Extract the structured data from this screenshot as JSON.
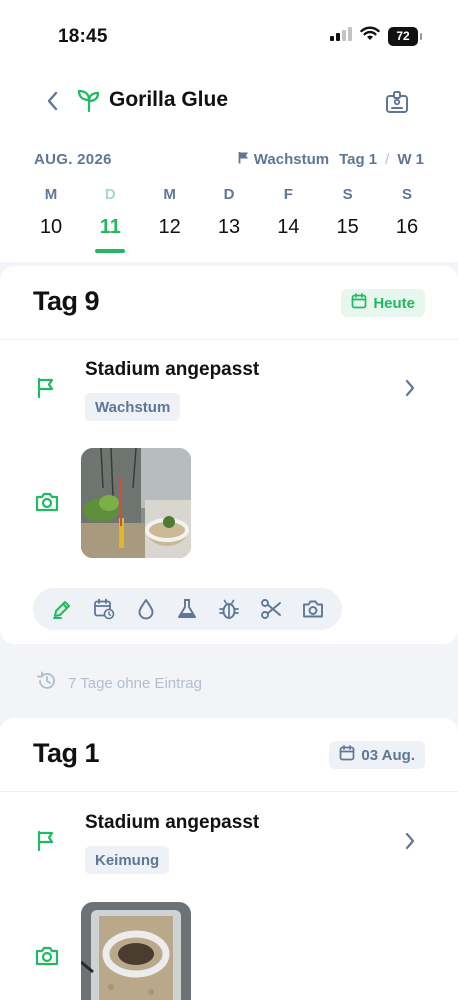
{
  "status_bar": {
    "time": "18:45",
    "battery": "72"
  },
  "header": {
    "title": "Gorilla Glue"
  },
  "calendar": {
    "month": "AUG. 2026",
    "phase": "Wachstum",
    "day_label": "Tag 1",
    "week_label": "W 1",
    "days": [
      {
        "weekday": "M",
        "num": "10"
      },
      {
        "weekday": "D",
        "num": "11"
      },
      {
        "weekday": "M",
        "num": "12"
      },
      {
        "weekday": "D",
        "num": "13"
      },
      {
        "weekday": "F",
        "num": "14"
      },
      {
        "weekday": "S",
        "num": "15"
      },
      {
        "weekday": "S",
        "num": "16"
      }
    ],
    "selected_index": 1
  },
  "cards": [
    {
      "title": "Tag 9",
      "badge": "Heute",
      "entry_title": "Stadium angepasst",
      "stage": "Wachstum",
      "actions": [
        "edit-icon",
        "calendar-repeat-icon",
        "water-drop-icon",
        "flask-icon",
        "bug-icon",
        "scissors-icon",
        "camera-icon"
      ]
    },
    {
      "title": "Tag 1",
      "badge": "03 Aug.",
      "entry_title": "Stadium angepasst",
      "stage": "Keimung"
    }
  ],
  "gap_notice": "7 Tage ohne Eintrag",
  "colors": {
    "accent": "#22b864",
    "muted": "#5f7796",
    "background": "#f2f4f7"
  }
}
